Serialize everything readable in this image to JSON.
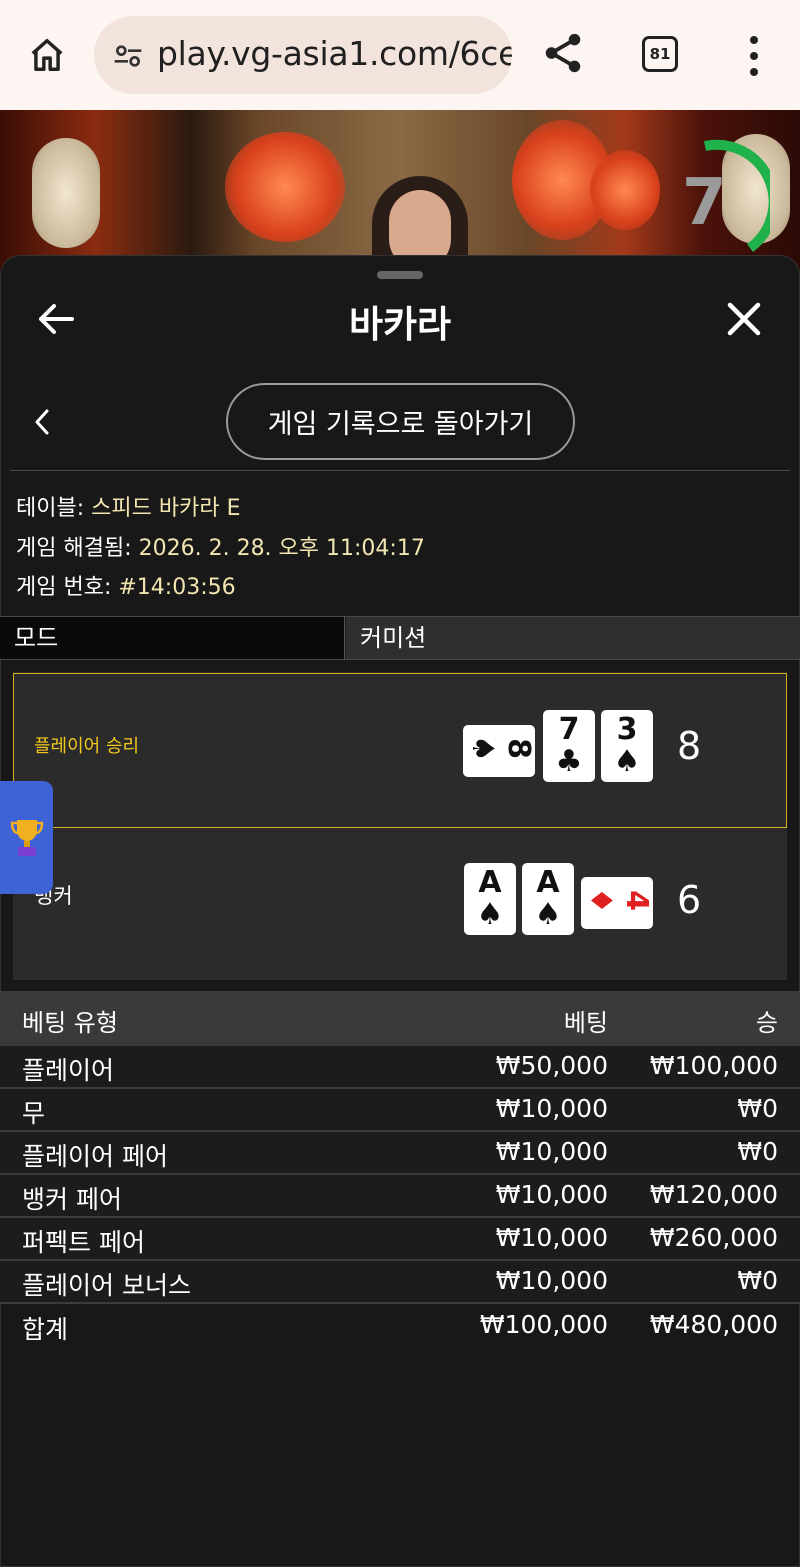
{
  "browser": {
    "url": "play.vg-asia1.com/6ce",
    "tab_count": "81"
  },
  "video": {
    "timer_value": "7"
  },
  "sheet": {
    "title": "바카라",
    "history_button": "게임 기록으로 돌아가기"
  },
  "info": {
    "table_label": "테이블: ",
    "table_value": "스피드 바카라 E",
    "resolved_label": "게임 해결됨: ",
    "resolved_value": "2026. 2. 28. 오후 11:04:17",
    "round_label": "게임 번호: ",
    "round_value": "#14:03:56"
  },
  "mode": {
    "label": "모드",
    "value": "커미션"
  },
  "result": {
    "player_label": "플레이어 승리",
    "player_score": "8",
    "player_cards": [
      {
        "rank": "8",
        "suit": "♠",
        "orientation": "horizontal"
      },
      {
        "rank": "7",
        "suit": "♣",
        "orientation": "vertical"
      },
      {
        "rank": "3",
        "suit": "♠",
        "orientation": "vertical"
      }
    ],
    "banker_label": "뱅커",
    "banker_score": "6",
    "banker_cards": [
      {
        "rank": "A",
        "suit": "♠",
        "orientation": "vertical"
      },
      {
        "rank": "A",
        "suit": "♠",
        "orientation": "vertical"
      },
      {
        "rank": "4",
        "suit": "♦",
        "orientation": "horizontal"
      }
    ]
  },
  "bets": {
    "headers": {
      "type": "베팅 유형",
      "bet": "베팅",
      "win": "승"
    },
    "rows": [
      {
        "type": "플레이어",
        "bet": "₩50,000",
        "win": "₩100,000"
      },
      {
        "type": "무",
        "bet": "₩10,000",
        "win": "₩0"
      },
      {
        "type": "플레이어 페어",
        "bet": "₩10,000",
        "win": "₩0"
      },
      {
        "type": "뱅커 페어",
        "bet": "₩10,000",
        "win": "₩120,000"
      },
      {
        "type": "퍼펙트 페어",
        "bet": "₩10,000",
        "win": "₩260,000"
      },
      {
        "type": "플레이어 보너스",
        "bet": "₩10,000",
        "win": "₩0"
      }
    ],
    "total": {
      "type": "합계",
      "bet": "₩100,000",
      "win": "₩480,000"
    }
  },
  "colors": {
    "accent_gold": "#f2c81e",
    "info_value": "#f2e5b0",
    "timer_green": "#1fb24a",
    "trophy_tab": "#3d63d6"
  }
}
